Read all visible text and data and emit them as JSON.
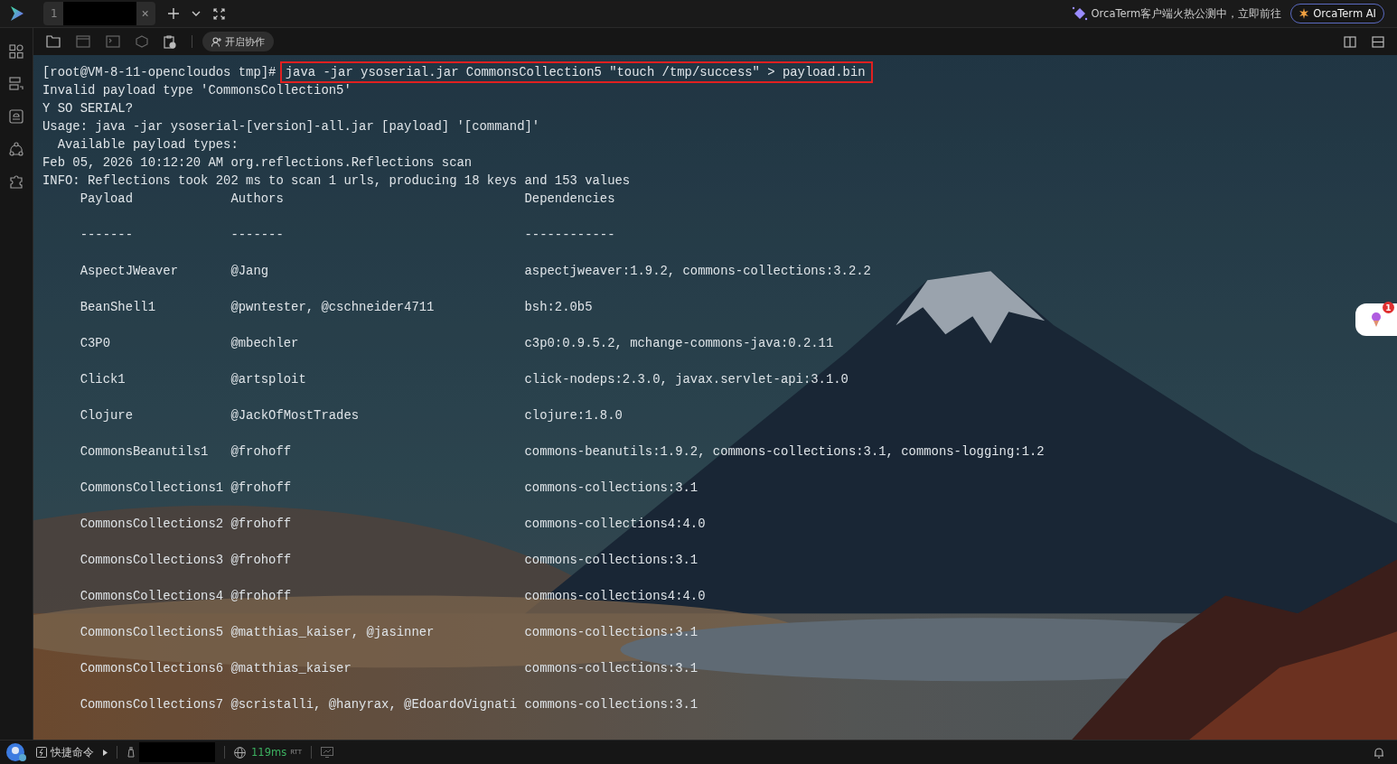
{
  "tabs": [
    {
      "number": "1",
      "selected": true
    }
  ],
  "banner": {
    "text": "OrcaTerm客户端火热公测中，立即前往"
  },
  "ai_button": {
    "label": "OrcaTerm AI"
  },
  "toolbar": {
    "collab_button": "开启协作"
  },
  "terminal": {
    "prompt": "[root@VM-8-11-opencloudos tmp]#",
    "command": "java -jar ysoserial.jar CommonsCollection5 \"touch /tmp/success\" > payload.bin",
    "command_highlighted": true,
    "output": [
      "Invalid payload type 'CommonsCollection5'",
      "Y SO SERIAL?",
      "Usage: java -jar ysoserial-[version]-all.jar [payload] '[command]'",
      "  Available payload types:",
      "Feb 05, 2026 10:12:20 AM org.reflections.Reflections scan",
      "INFO: Reflections took 202 ms to scan 1 urls, producing 18 keys and 153 values"
    ],
    "table": {
      "columns": [
        "Payload",
        "Authors",
        "Dependencies"
      ],
      "separators": [
        "-------",
        "-------",
        "------------"
      ],
      "rows": [
        {
          "payload": "AspectJWeaver",
          "authors": "@Jang",
          "dependencies": "aspectjweaver:1.9.2, commons-collections:3.2.2"
        },
        {
          "payload": "BeanShell1",
          "authors": "@pwntester, @cschneider4711",
          "dependencies": "bsh:2.0b5"
        },
        {
          "payload": "C3P0",
          "authors": "@mbechler",
          "dependencies": "c3p0:0.9.5.2, mchange-commons-java:0.2.11"
        },
        {
          "payload": "Click1",
          "authors": "@artsploit",
          "dependencies": "click-nodeps:2.3.0, javax.servlet-api:3.1.0"
        },
        {
          "payload": "Clojure",
          "authors": "@JackOfMostTrades",
          "dependencies": "clojure:1.8.0"
        },
        {
          "payload": "CommonsBeanutils1",
          "authors": "@frohoff",
          "dependencies": "commons-beanutils:1.9.2, commons-collections:3.1, commons-logging:1.2"
        },
        {
          "payload": "CommonsCollections1",
          "authors": "@frohoff",
          "dependencies": "commons-collections:3.1"
        },
        {
          "payload": "CommonsCollections2",
          "authors": "@frohoff",
          "dependencies": "commons-collections4:4.0"
        },
        {
          "payload": "CommonsCollections3",
          "authors": "@frohoff",
          "dependencies": "commons-collections:3.1"
        },
        {
          "payload": "CommonsCollections4",
          "authors": "@frohoff",
          "dependencies": "commons-collections4:4.0"
        },
        {
          "payload": "CommonsCollections5",
          "authors": "@matthias_kaiser, @jasinner",
          "dependencies": "commons-collections:3.1"
        },
        {
          "payload": "CommonsCollections6",
          "authors": "@matthias_kaiser",
          "dependencies": "commons-collections:3.1"
        },
        {
          "payload": "CommonsCollections7",
          "authors": "@scristalli, @hanyrax, @EdoardoVignati",
          "dependencies": "commons-collections:3.1"
        }
      ]
    }
  },
  "floating_widget": {
    "badge": "1"
  },
  "status_bar": {
    "quick_commands": "快捷命令",
    "latency": "119ms",
    "latency_unit": "RTT"
  }
}
